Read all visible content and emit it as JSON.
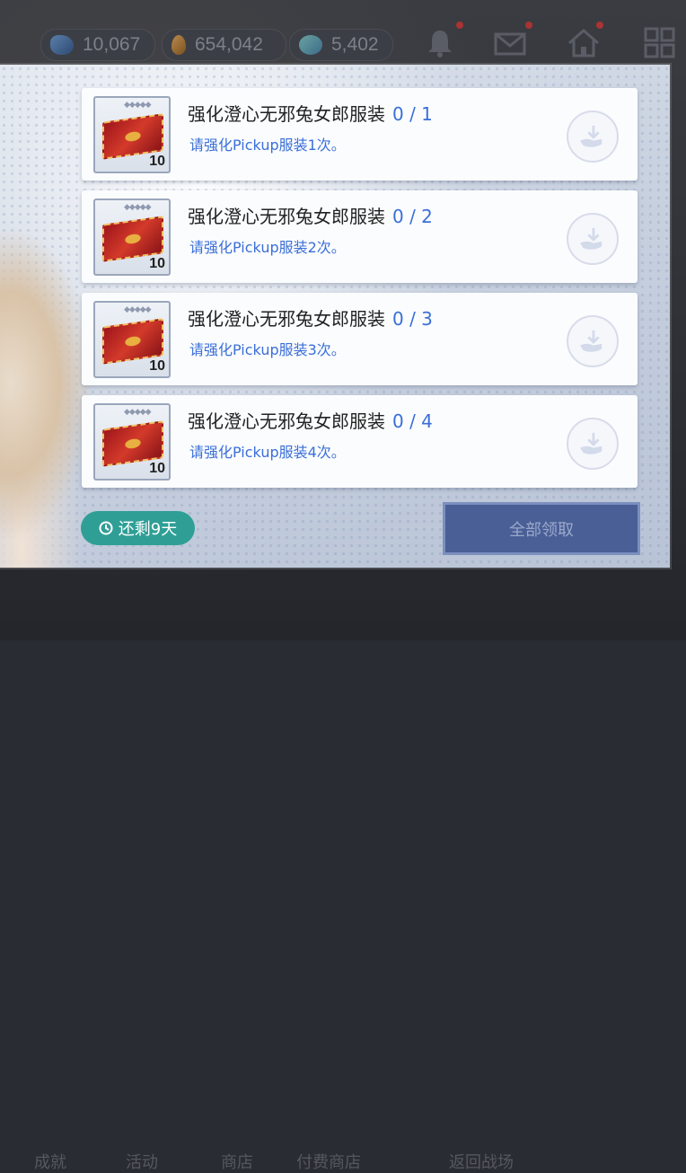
{
  "resources": [
    {
      "icon": "gem-icon",
      "value": "10,067"
    },
    {
      "icon": "gold-icon",
      "value": "654,042"
    },
    {
      "icon": "stamina-icon",
      "value": "5,402"
    }
  ],
  "bottom_nav": [
    "成就",
    "活动",
    "商店",
    "付费商店",
    "返回战场"
  ],
  "quests": [
    {
      "title": "强化澄心无邪兔女郎服装",
      "progress": "0 / 1",
      "desc": "请强化Pickup服装1次。",
      "reward_qty": "10"
    },
    {
      "title": "强化澄心无邪兔女郎服装",
      "progress": "0 / 2",
      "desc": "请强化Pickup服装2次。",
      "reward_qty": "10"
    },
    {
      "title": "强化澄心无邪兔女郎服装",
      "progress": "0 / 3",
      "desc": "请强化Pickup服装3次。",
      "reward_qty": "10"
    },
    {
      "title": "强化澄心无邪兔女郎服装",
      "progress": "0 / 4",
      "desc": "请强化Pickup服装4次。",
      "reward_qty": "10"
    }
  ],
  "timer": {
    "label": "还剩9天"
  },
  "claim_all": {
    "label": "全部领取"
  },
  "colors": {
    "accent_blue": "#3a6fd8",
    "timer_teal": "#2f9f96",
    "button_navy": "#4a5f96"
  }
}
